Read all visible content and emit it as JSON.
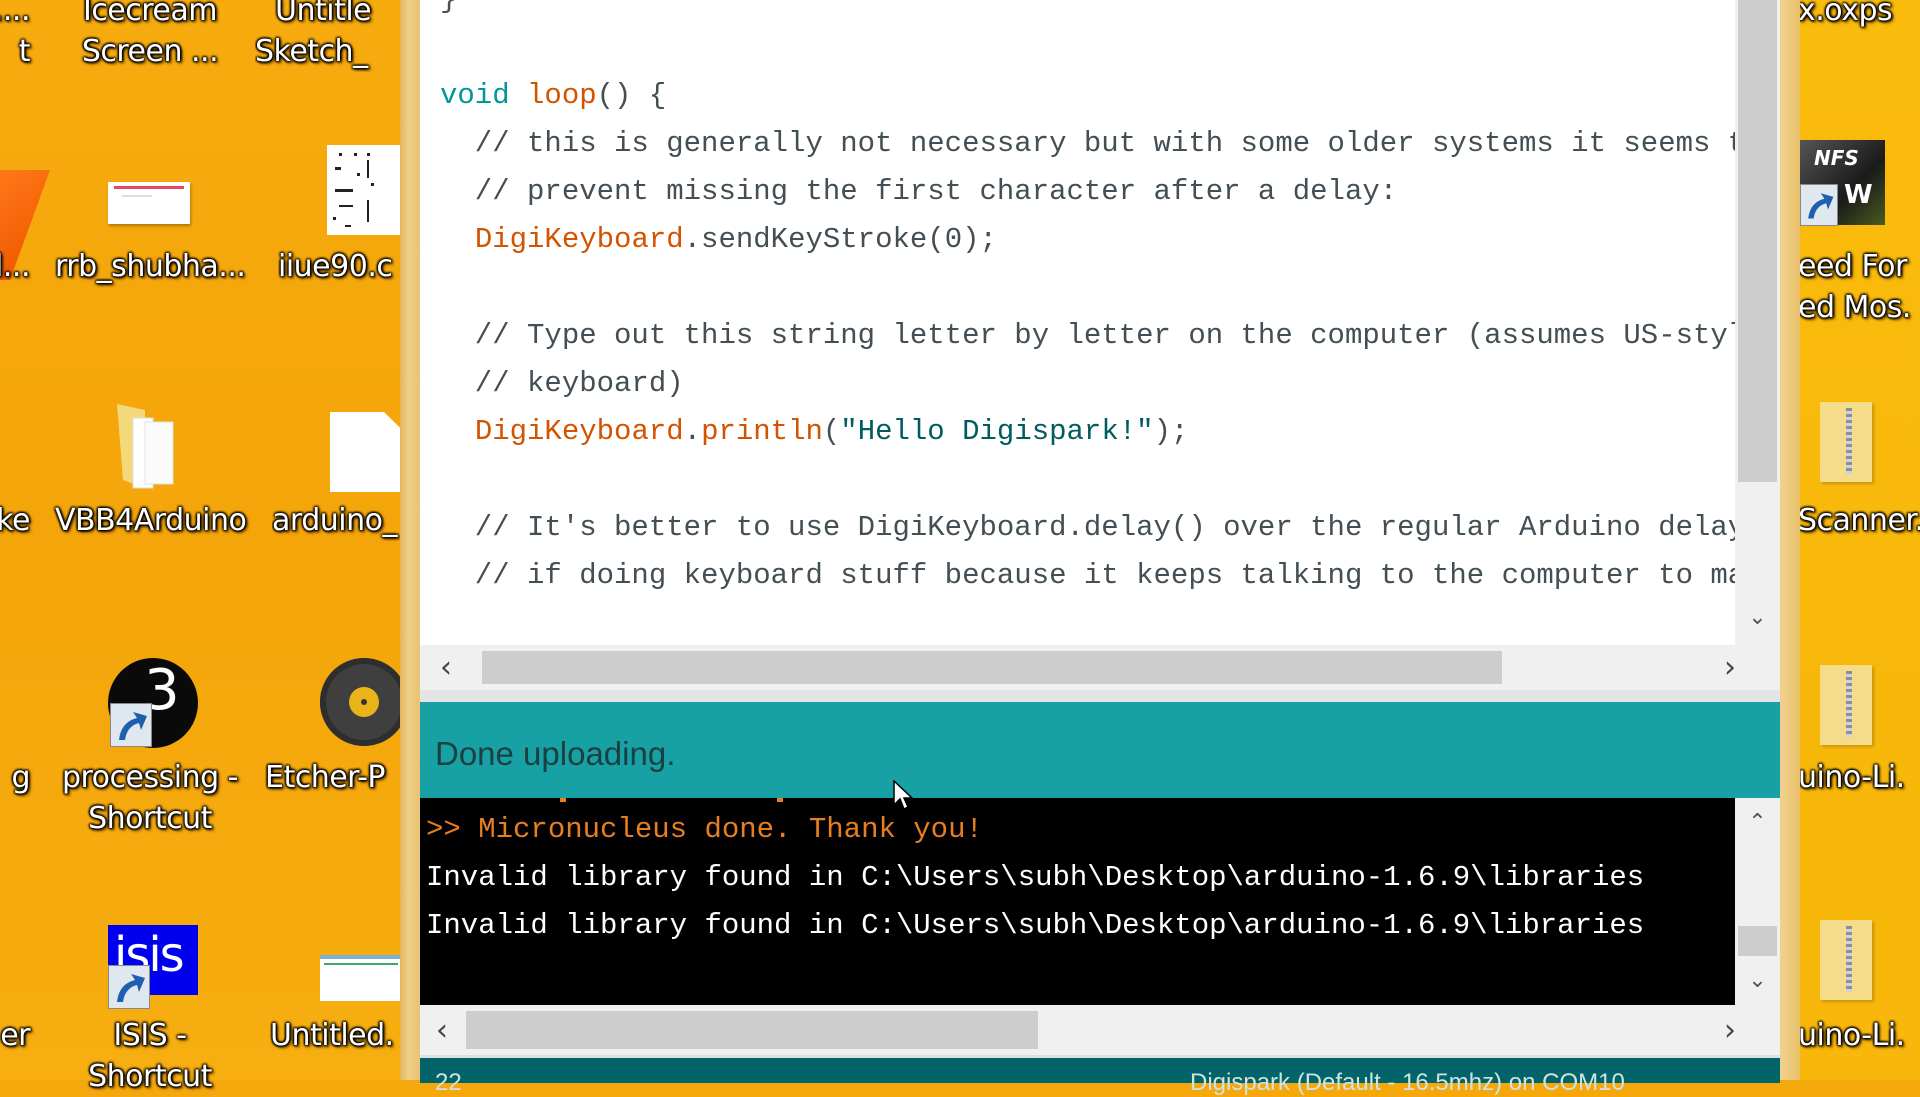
{
  "desktop": {
    "left_icons": [
      {
        "label_line1": "Icecream",
        "label_line2": "Screen ...",
        "icon": "icecream-icon"
      },
      {
        "label_line1": "Untitle",
        "label_line2": "Sketch_",
        "icon": "sketch-icon"
      },
      {
        "label_line1": "....",
        "label_line2": "t",
        "icon": "partial-icon"
      },
      {
        "label_line1": "rrb_shubha...",
        "label_line2": "",
        "icon": "document-icon"
      },
      {
        "label_line1": "iiue90.c",
        "label_line2": "",
        "icon": "image-icon"
      },
      {
        "label_line1": "l...",
        "label_line2": "",
        "icon": "partial-icon"
      },
      {
        "label_line1": "VBB4Arduino",
        "label_line2": "",
        "icon": "folder-icon"
      },
      {
        "label_line1": "arduino_",
        "label_line2": "",
        "icon": "file-icon"
      },
      {
        "label_line1": "ke",
        "label_line2": "",
        "icon": "partial-icon"
      },
      {
        "label_line1": "processing -",
        "label_line2": "Shortcut",
        "icon": "processing-icon"
      },
      {
        "label_line1": "Etcher-P",
        "label_line2": "",
        "icon": "disc-icon"
      },
      {
        "label_line1": "g",
        "label_line2": "",
        "icon": "partial-icon"
      },
      {
        "label_line1": "ISIS -",
        "label_line2": "Shortcut",
        "icon": "isis-icon"
      },
      {
        "label_line1": "Untitled.",
        "label_line2": "",
        "icon": "window-image-icon"
      },
      {
        "label_line1": "er",
        "label_line2": "",
        "icon": "partial-icon"
      }
    ],
    "right_icons": [
      {
        "label_line1": "x.oxps",
        "label_line2": "",
        "icon": "document-icon"
      },
      {
        "label_line1": "eed For",
        "label_line2": "ed Mos.",
        "icon": "nfs-game-icon"
      },
      {
        "label_line1": "Scanner.",
        "label_line2": "",
        "icon": "zip-folder-icon"
      },
      {
        "label_line1": "uino-Li.",
        "label_line2": "",
        "icon": "zip-folder-icon"
      },
      {
        "label_line1": "uino-Li.",
        "label_line2": "",
        "icon": "zip-folder-icon"
      }
    ],
    "processing_badge": "3",
    "isis_badge": "isis"
  },
  "editor": {
    "lines": [
      [
        {
          "t": "}",
          "c": "plain"
        }
      ],
      [
        {
          "t": "",
          "c": "plain"
        }
      ],
      [
        {
          "t": "void",
          "c": "type"
        },
        {
          "t": " ",
          "c": "plain"
        },
        {
          "t": "loop",
          "c": "fn"
        },
        {
          "t": "() {",
          "c": "plain"
        }
      ],
      [
        {
          "t": "  // this is generally not necessary but with some older systems it seems to",
          "c": "cmt"
        }
      ],
      [
        {
          "t": "  // prevent missing the first character after a delay:",
          "c": "cmt"
        }
      ],
      [
        {
          "t": "  ",
          "c": "plain"
        },
        {
          "t": "DigiKeyboard",
          "c": "cls"
        },
        {
          "t": ".sendKeyStroke(0);",
          "c": "plain"
        }
      ],
      [
        {
          "t": "",
          "c": "plain"
        }
      ],
      [
        {
          "t": "  // Type out this string letter by letter on the computer (assumes US-style",
          "c": "cmt"
        }
      ],
      [
        {
          "t": "  // keyboard)",
          "c": "cmt"
        }
      ],
      [
        {
          "t": "  ",
          "c": "plain"
        },
        {
          "t": "DigiKeyboard",
          "c": "cls"
        },
        {
          "t": ".",
          "c": "plain"
        },
        {
          "t": "println",
          "c": "fn"
        },
        {
          "t": "(",
          "c": "plain"
        },
        {
          "t": "\"Hello Digispark!\"",
          "c": "str"
        },
        {
          "t": ");",
          "c": "plain"
        }
      ],
      [
        {
          "t": "",
          "c": "plain"
        }
      ],
      [
        {
          "t": "  // It's better to use DigiKeyboard.delay() over the regular Arduino delay()",
          "c": "cmt"
        }
      ],
      [
        {
          "t": "  // if doing keyboard stuff because it keeps talking to the computer to make",
          "c": "cmt"
        }
      ]
    ]
  },
  "status": {
    "message": "Done uploading."
  },
  "console": {
    "lines": [
      {
        "text": ">> Micronucleus done. Thank you!",
        "kind": "err"
      },
      {
        "text": "Invalid library found in C:\\Users\\subh\\Desktop\\arduino-1.6.9\\libraries",
        "kind": "info"
      },
      {
        "text": "Invalid library found in C:\\Users\\subh\\Desktop\\arduino-1.6.9\\libraries",
        "kind": "info"
      }
    ]
  },
  "footer": {
    "line_number": "22",
    "board": "Digispark (Default - 16.5mhz) on COM10"
  },
  "colors": {
    "status_bar": "#17a1a5",
    "footer_bar": "#006468",
    "console_error": "#e67e22",
    "keyword_type": "#00979c",
    "keyword_function": "#d35400"
  }
}
